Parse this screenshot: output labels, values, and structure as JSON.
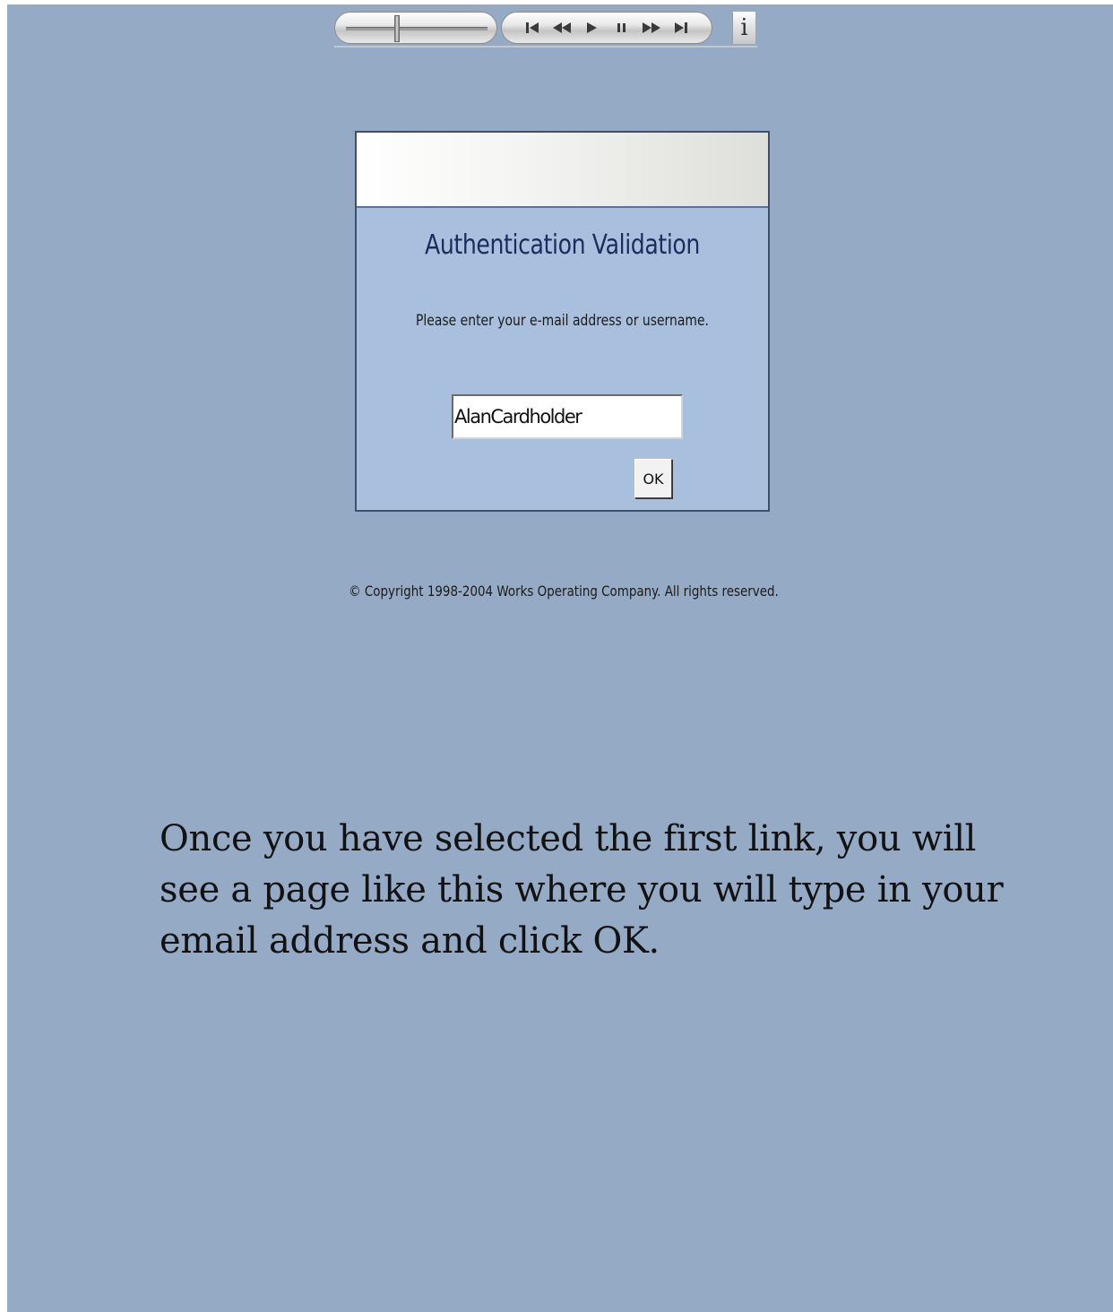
{
  "player": {
    "controls": [
      {
        "name": "skip-to-start-icon"
      },
      {
        "name": "rewind-icon"
      },
      {
        "name": "play-icon"
      },
      {
        "name": "pause-icon"
      },
      {
        "name": "fast-forward-icon"
      },
      {
        "name": "skip-to-end-icon"
      }
    ],
    "info_label": "i"
  },
  "dialog": {
    "title": "Authentication Validation",
    "prompt": "Please enter your e-mail address or username.",
    "input_value": "AlanCardholder",
    "ok_label": "OK"
  },
  "footer": {
    "copyright": "© Copyright 1998-2004 Works Operating Company. All rights reserved."
  },
  "caption": {
    "text": "Once you have selected the first link, you will see a page like this where you will type in your email address and click OK."
  },
  "colors": {
    "background": "#95abc5",
    "dialog_body": "#a8c0de",
    "dialog_border": "#3a5073",
    "title_text": "#1c2c5c"
  }
}
